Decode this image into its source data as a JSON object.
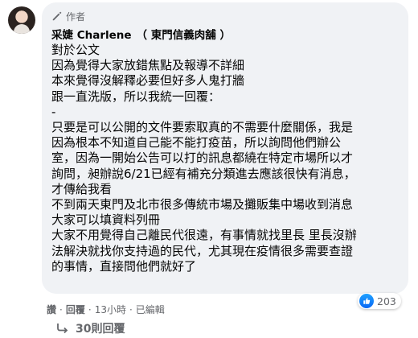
{
  "comment": {
    "author_badge": "作者",
    "author_name": "采婕 Charlene",
    "author_page": "（ 東門信義肉舖 ）",
    "lines": [
      "對於公文",
      "因為覺得大家放錯焦點及報導不詳細",
      "本來覺得沒解釋必要但好多人鬼打牆",
      "跟一直洗版，所以我統一回覆：",
      "-",
      "只要是可以公開的文件要索取真的不需要什麼關係，我是",
      "因為根本不知道自己能不能打疫苗，所以詢問他們辦公",
      "室，因為一開始公告可以打的訊息都繞在特定市場所以才",
      "詢問，昶辦說6/21已經有補充分類進去應該很快有消息，",
      "才傳給我看",
      "不到兩天東門及北市很多傳統市場及攤販集中場收到消息",
      "大家可以填資料列冊",
      "大家不用覺得自己離民代很遠，有事情就找里長 里長沒辦",
      "法解決就找你支持過的民代，尤其現在疫情很多需要查證",
      "的事情，直接問他們就好了"
    ],
    "actions": {
      "like": "讚",
      "reply": "回覆",
      "time": "13小時",
      "edited": "已編輯",
      "dot": "·"
    },
    "reaction_count": "203",
    "view_replies": "30則回覆"
  },
  "icons": {
    "author_badge": "pen-icon",
    "reaction": "thumbs-up-icon",
    "replies": "reply-arrow-icon"
  },
  "colors": {
    "bubble": "#f0f2f5",
    "secondary_text": "#65676b",
    "like_blue": "#1877f2"
  }
}
